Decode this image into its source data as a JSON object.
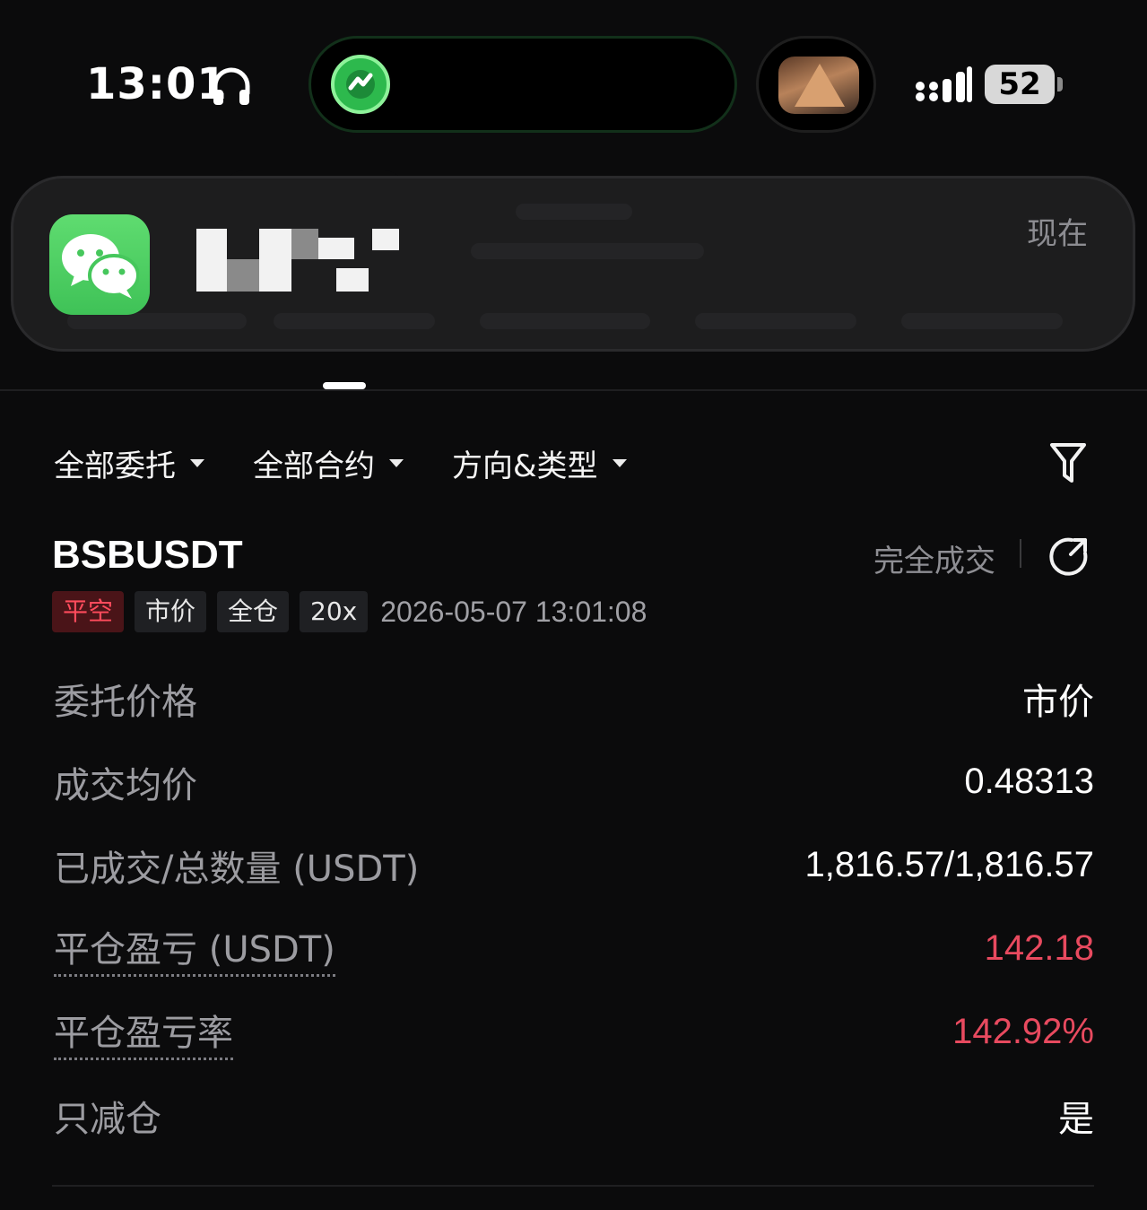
{
  "status_bar": {
    "time": "13:01",
    "headphone_icon": "headphone-icon",
    "signal_icon": "cellular-signal-icon",
    "battery": "52"
  },
  "notification": {
    "app_icon": "wechat-icon",
    "time": "现在"
  },
  "filters": [
    {
      "label": "全部委托"
    },
    {
      "label": "全部合约"
    },
    {
      "label": "方向&类型"
    }
  ],
  "filter_icon": "funnel-icon",
  "order": {
    "symbol": "BSBUSDT",
    "status": "完全成交",
    "share_icon": "share-icon",
    "tags": [
      "平空",
      "市价",
      "全仓",
      "20x"
    ],
    "timestamp": "2026-05-07 13:01:08",
    "rows": [
      {
        "label": "委托价格",
        "value": "市价"
      },
      {
        "label": "成交均价",
        "value": "0.48313"
      },
      {
        "label": "已成交/总数量 (USDT)",
        "value": "1,816.57/1,816.57"
      },
      {
        "label": "平仓盈亏 (USDT)",
        "value": "142.18"
      },
      {
        "label": "平仓盈亏率",
        "value": "142.92%"
      },
      {
        "label": "只减仓",
        "value": "是"
      }
    ]
  },
  "colors": {
    "background": "#0b0b0c",
    "pnl_red": "#e84a5f",
    "danger_tag_bg": "#4a1418",
    "danger_tag_text": "#ff4b5c",
    "muted_text": "#9c9ca1"
  }
}
